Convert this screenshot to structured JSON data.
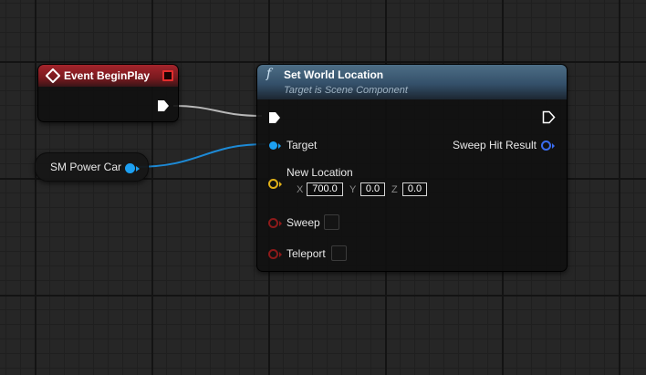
{
  "graph": {
    "event_node": {
      "title": "Event BeginPlay",
      "header_color": "#a3242b"
    },
    "variable_node": {
      "label": "SM Power Car",
      "pin_color": "#1da0f2"
    },
    "function_node": {
      "icon": "function-icon",
      "icon_glyph": "f",
      "title": "Set World Location",
      "subtitle": "Target is Scene Component",
      "header_color": "#4d6e86",
      "pins": {
        "target_label": "Target",
        "sweep_hit_result_label": "Sweep Hit Result",
        "new_location_label": "New Location",
        "new_location": {
          "x_label": "X",
          "x_value": "700.0",
          "y_label": "Y",
          "y_value": "0.0",
          "z_label": "Z",
          "z_value": "0.0"
        },
        "sweep_label": "Sweep",
        "sweep_checked": false,
        "teleport_label": "Teleport",
        "teleport_checked": false
      }
    },
    "colors": {
      "object_pin": "#1da0f2",
      "vector_pin": "#e0b018",
      "bool_pin": "#8d1a1a",
      "struct_pin": "#3a6cf0",
      "exec_pin": "#ffffff"
    }
  }
}
